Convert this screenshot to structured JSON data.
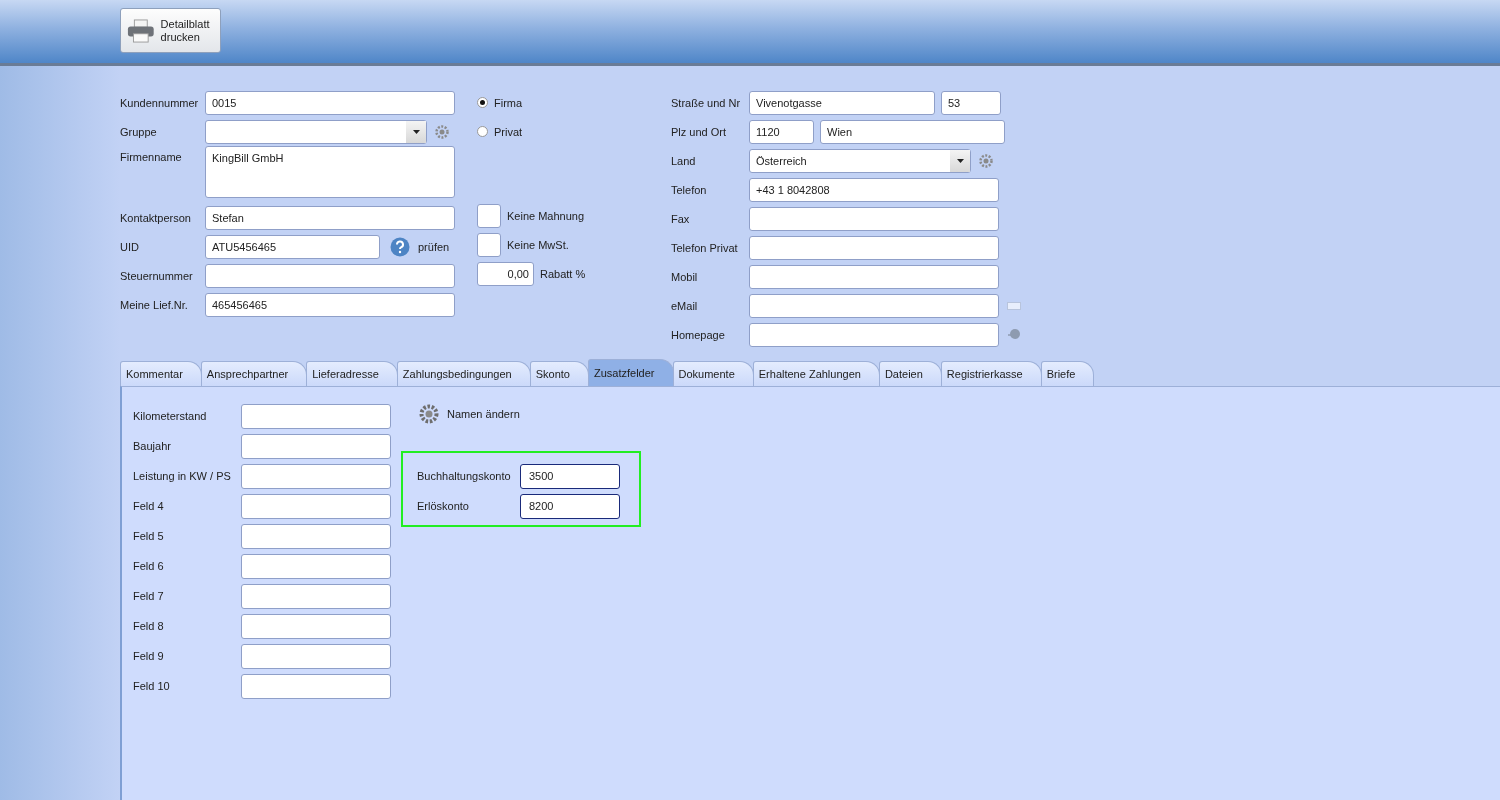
{
  "toolbar": {
    "print_button": "Detailblatt drucken"
  },
  "customer": {
    "fields": [
      {
        "kind": "text",
        "label": "Kundennummer",
        "value": "0015"
      },
      {
        "kind": "select",
        "label": "Gruppe"
      },
      {
        "kind": "textarea",
        "label": "Firmenname",
        "value": "KingBill GmbH"
      },
      {
        "kind": "text",
        "label": "Kontaktperson",
        "value": "Stefan"
      },
      {
        "kind": "uid",
        "label": "UID",
        "value": "ATU5456465",
        "link": "prüfen"
      },
      {
        "kind": "text",
        "label": "Steuernummer"
      },
      {
        "kind": "text",
        "label": "Meine Lief.Nr.",
        "value": "465456465"
      }
    ],
    "type_options": [
      {
        "label": "Firma",
        "selected": true
      },
      {
        "label": "Privat",
        "selected": false
      }
    ],
    "flags": [
      {
        "label": "Keine Mahnung",
        "checked": false
      },
      {
        "label": "Keine MwSt.",
        "checked": false
      }
    ],
    "discount": {
      "value": "0,00",
      "label": "Rabatt %"
    }
  },
  "address": [
    {
      "kind": "pair",
      "label": "Straße und Nr",
      "values": [
        "Vivenotgasse",
        "53"
      ]
    },
    {
      "kind": "zip",
      "label": "Plz und Ort",
      "values": [
        "1120",
        "Wien"
      ]
    },
    {
      "kind": "select",
      "label": "Land",
      "value": "Österreich"
    },
    {
      "kind": "text",
      "label": "Telefon",
      "value": "+43 1 8042808"
    },
    {
      "kind": "text",
      "label": "Fax"
    },
    {
      "kind": "text",
      "label": "Telefon Privat"
    },
    {
      "kind": "text",
      "label": "Mobil"
    },
    {
      "kind": "email",
      "label": "eMail"
    },
    {
      "kind": "web",
      "label": "Homepage"
    }
  ],
  "tabs": [
    {
      "label": "Kommentar",
      "selected": false
    },
    {
      "label": "Ansprechpartner",
      "selected": false
    },
    {
      "label": "Lieferadresse",
      "selected": false
    },
    {
      "label": "Zahlungsbedingungen",
      "selected": false
    },
    {
      "label": "Skonto",
      "selected": false
    },
    {
      "label": "Zusatzfelder",
      "selected": true
    },
    {
      "label": "Dokumente",
      "selected": false
    },
    {
      "label": "Erhaltene Zahlungen",
      "selected": false
    },
    {
      "label": "Dateien",
      "selected": false
    },
    {
      "label": "Registrierkasse",
      "selected": false
    },
    {
      "label": "Briefe",
      "selected": false
    }
  ],
  "extra_fields": [
    {
      "label": "Kilometerstand"
    },
    {
      "label": "Baujahr"
    },
    {
      "label": "Leistung in KW / PS"
    },
    {
      "label": "Feld 4"
    },
    {
      "label": "Feld 5"
    },
    {
      "label": "Feld 6"
    },
    {
      "label": "Feld 7"
    },
    {
      "label": "Feld 8"
    },
    {
      "label": "Feld 9"
    },
    {
      "label": "Feld 10"
    }
  ],
  "rename_button": "Namen ändern",
  "accounts": [
    {
      "label": "Buchhaltungskonto",
      "value": "3500"
    },
    {
      "label": "Erlöskonto",
      "value": "8200"
    }
  ]
}
